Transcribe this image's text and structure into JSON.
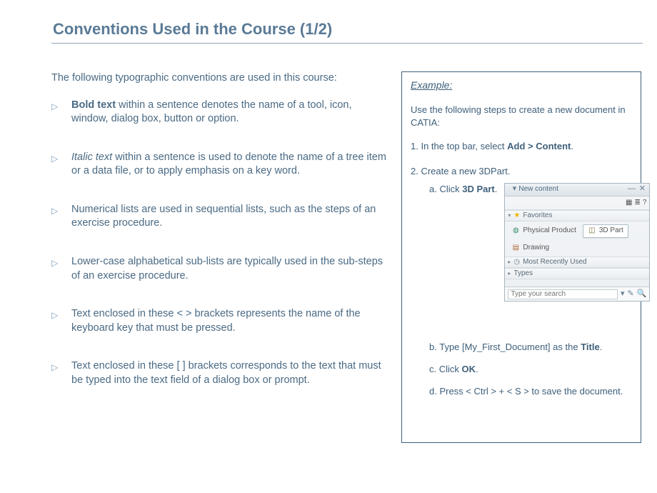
{
  "title": "Conventions Used in the Course (1/2)",
  "intro": "The following typographic conventions are used in this course:",
  "conv": {
    "bold_lead": "Bold text",
    "bold_rest": " within a sentence denotes the name of a tool, icon, window, dialog box, button or option.",
    "italic_lead": "Italic text",
    "italic_rest": " within a sentence is used to denote the name of a tree item or a data file, or to apply emphasis on a key word.",
    "num": "Numerical lists are used in sequential lists, such as the steps of an exercise procedure.",
    "alpha": "Lower-case alphabetical sub-lists are typically used in the sub-steps of an exercise procedure.",
    "angle": "Text enclosed in these < > brackets represents the name of the keyboard key that must be pressed.",
    "square": "Text enclosed in these [ ] brackets corresponds to the text that must be typed into the text field of a dialog box or prompt."
  },
  "example": {
    "heading": "Example:",
    "intro": "Use the following steps to create a new document in CATIA:",
    "step1_pre": "1. In the top bar, select ",
    "step1_bold": "Add > Content",
    "step1_post": ".",
    "step2": "2. Create a new 3DPart.",
    "step2a_pre": "a. Click ",
    "step2a_bold": "3D Part",
    "step2a_post": ".",
    "step2b_pre": "b. Type [My_First_Document] as the ",
    "step2b_bold": "Title",
    "step2b_post": ".",
    "step2c_pre": "c. Click ",
    "step2c_bold": "OK",
    "step2c_post": ".",
    "step2d": "d. Press < Ctrl > + < S > to save the document."
  },
  "panel": {
    "title": "New content",
    "favorites": "Favorites",
    "physical": "Physical Product",
    "part3d": "3D Part",
    "drawing": "Drawing",
    "mru": "Most Recently Used",
    "types": "Types",
    "search_ph": "Type your search"
  }
}
